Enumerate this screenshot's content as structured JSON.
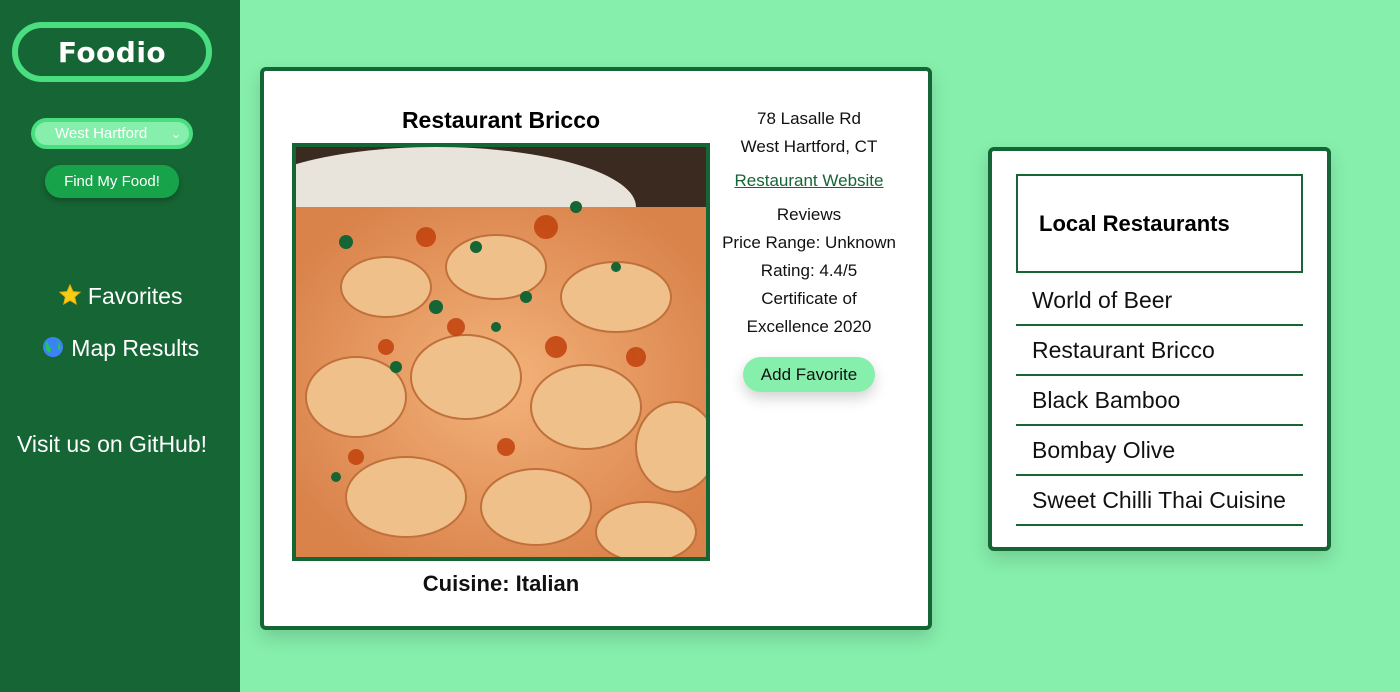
{
  "sidebar": {
    "logo": "Foodio",
    "city_select": "West Hartford",
    "find_button": "Find My Food!",
    "nav": [
      {
        "icon": "star-icon",
        "label": "Favorites"
      },
      {
        "icon": "globe-icon",
        "label": "Map Results"
      }
    ],
    "github": "Visit us on GitHub!"
  },
  "detail": {
    "name": "Restaurant Bricco",
    "cuisine": "Cuisine: Italian",
    "address_line1": "78 Lasalle Rd",
    "address_line2": "West Hartford, CT",
    "website_link": "Restaurant Website",
    "reviews_label": "Reviews",
    "price_range": "Price Range: Unknown",
    "rating": "Rating: 4.4/5",
    "certificate_line1": "Certificate of",
    "certificate_line2": "Excellence 2020",
    "favorite_button": "Add Favorite"
  },
  "local": {
    "title": "Local Restaurants",
    "items": [
      "World of Beer",
      "Restaurant Bricco",
      "Black Bamboo",
      "Bombay Olive",
      "Sweet Chilli Thai Cuisine"
    ]
  },
  "colors": {
    "page_bg": "#86efac",
    "sidebar_bg": "#166534",
    "accent": "#4ade80",
    "button_green": "#16a34a"
  }
}
